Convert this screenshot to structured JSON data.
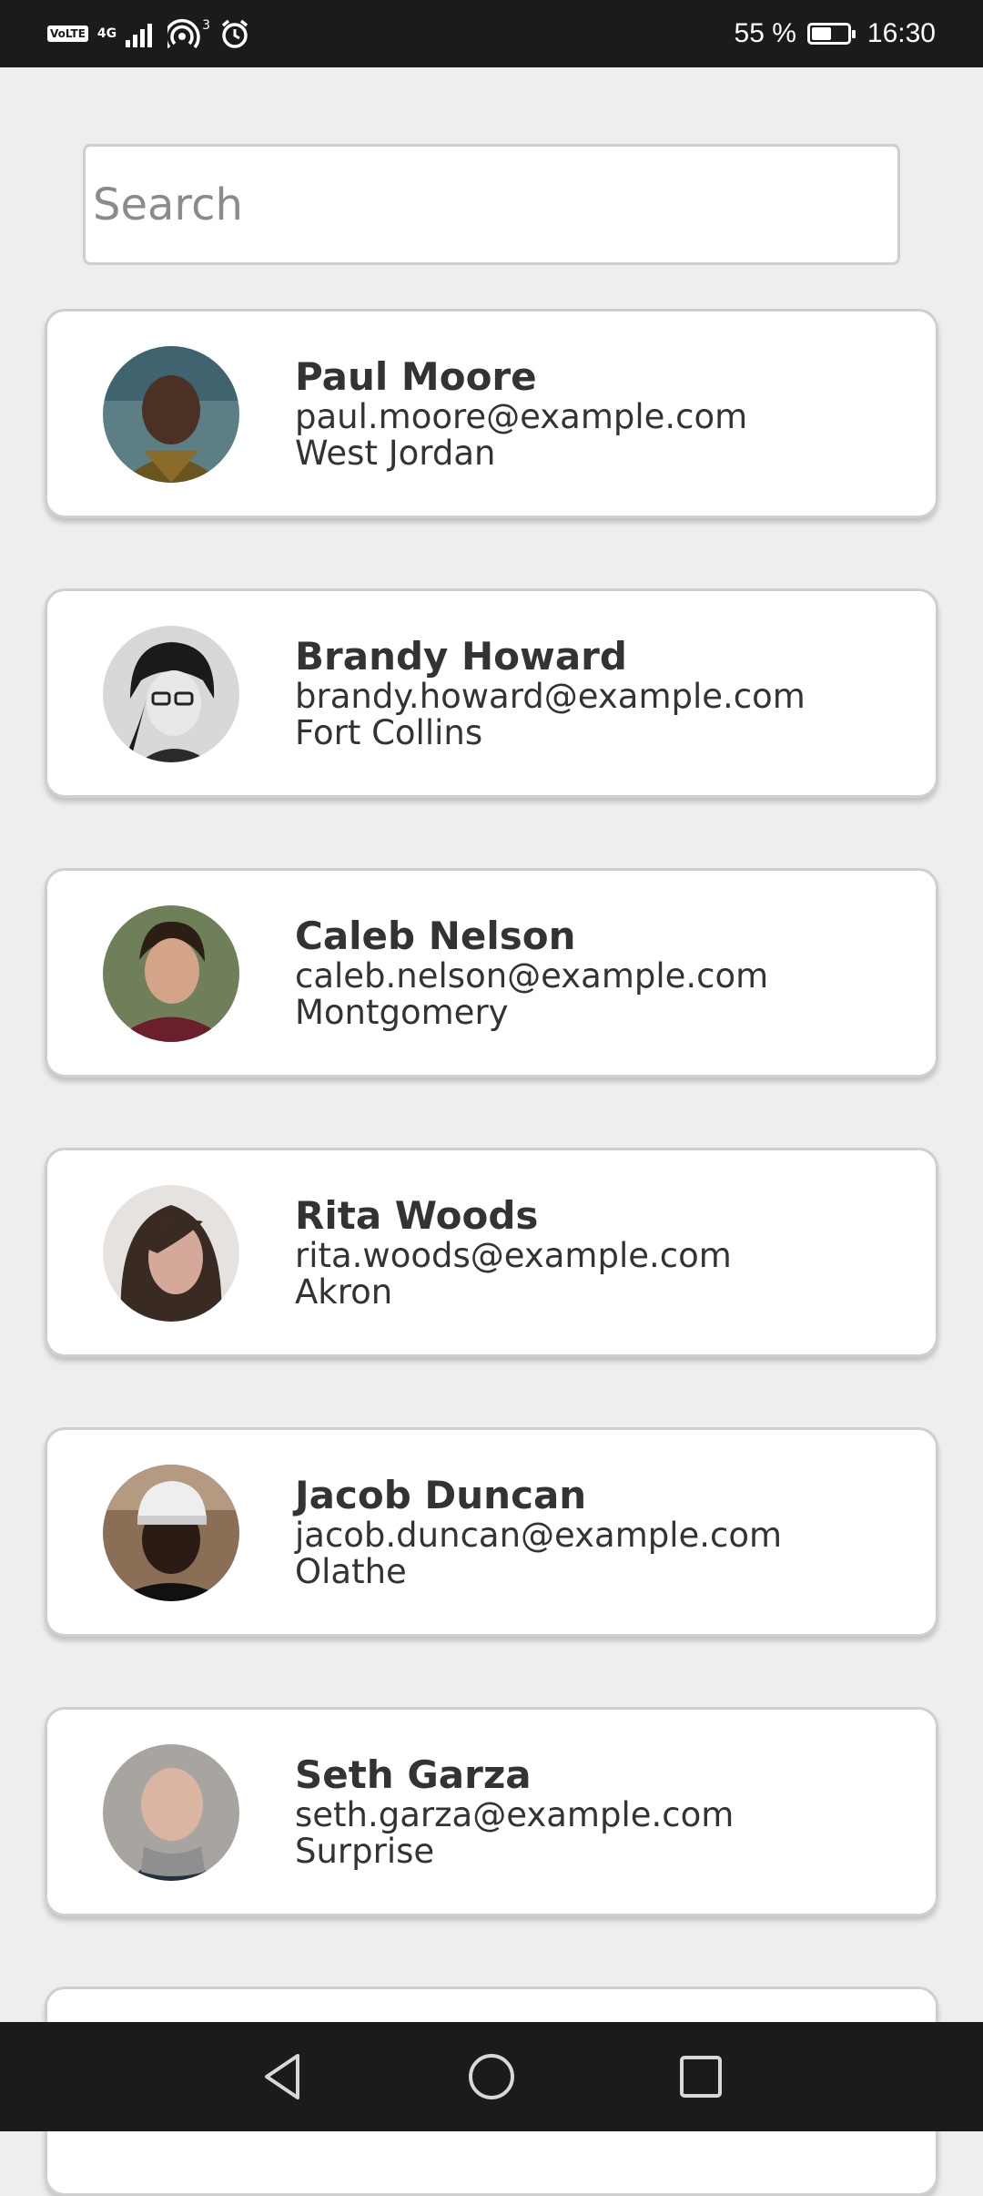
{
  "status_bar": {
    "volte": "VoLTE",
    "network": "4G",
    "hotspot_count": "3",
    "battery_percent": "55 %",
    "battery_level": 0.55,
    "time": "16:30"
  },
  "search": {
    "placeholder": "Search",
    "value": ""
  },
  "contacts": [
    {
      "name": "Paul Moore",
      "email": "paul.moore@example.com",
      "city": "West Jordan"
    },
    {
      "name": "Brandy Howard",
      "email": "brandy.howard@example.com",
      "city": "Fort Collins"
    },
    {
      "name": "Caleb Nelson",
      "email": "caleb.nelson@example.com",
      "city": "Montgomery"
    },
    {
      "name": "Rita Woods",
      "email": "rita.woods@example.com",
      "city": "Akron"
    },
    {
      "name": "Jacob Duncan",
      "email": "jacob.duncan@example.com",
      "city": "Olathe"
    },
    {
      "name": "Seth Garza",
      "email": "seth.garza@example.com",
      "city": "Surprise"
    }
  ],
  "nav": {
    "icons": [
      "back-icon",
      "home-icon",
      "recents-icon"
    ]
  }
}
